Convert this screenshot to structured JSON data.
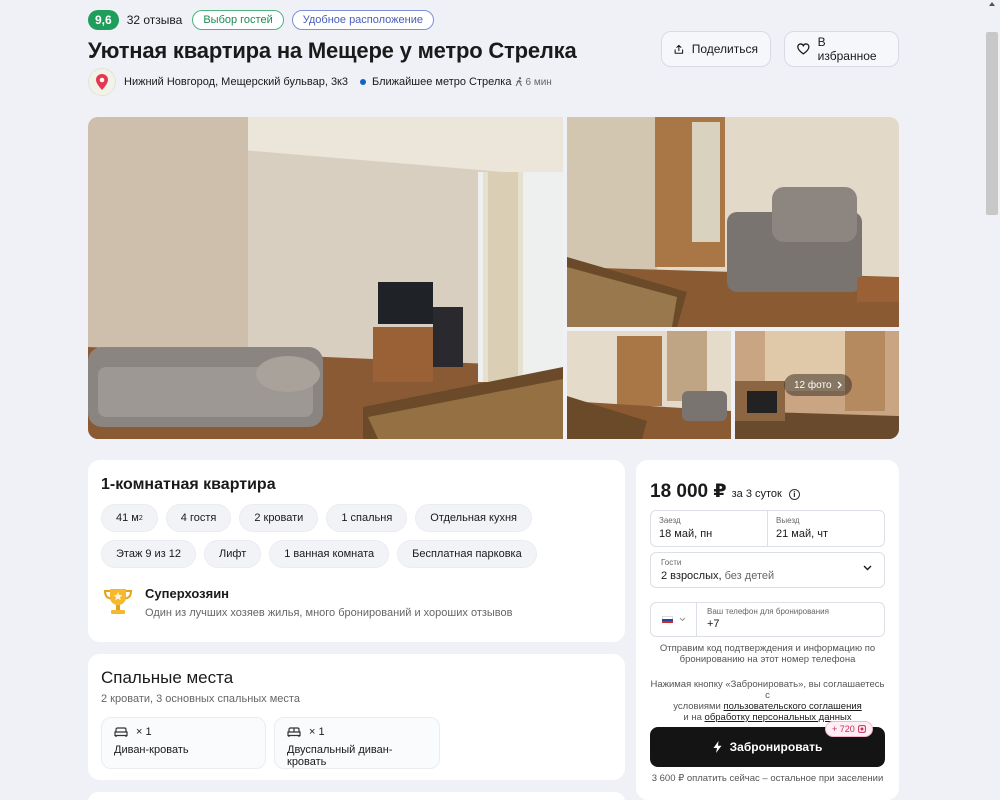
{
  "header": {
    "rating": "9,6",
    "reviews": "32 отзыва",
    "badges": [
      "Выбор гостей",
      "Удобное расположение"
    ],
    "title": "Уютная квартира на Мещере у метро Стрелка",
    "address": "Нижний Новгород, Мещерский бульвар, 3к3",
    "metro": "Ближайшее метро Стрелка",
    "walk_time": "6 мин",
    "share_label": "Поделиться",
    "favorite_label": "В избранное"
  },
  "gallery": {
    "photos_button": "12 фото"
  },
  "info": {
    "heading": "1-комнатная квартира",
    "area_value": "41 м",
    "area_unit_sup": "2",
    "chips_row1": [
      "4 гостя",
      "2 кровати",
      "1 спальня",
      "Отдельная кухня"
    ],
    "chips_row2": [
      "Этаж 9 из 12",
      "Лифт",
      "1 ванная комната",
      "Бесплатная парковка"
    ],
    "host_title": "Суперхозяин",
    "host_desc": "Один из лучших хозяев жилья, много бронирований и хороших отзывов"
  },
  "beds": {
    "heading": "Спальные места",
    "subtitle": "2 кровати, 3 основных спальных места",
    "items": [
      {
        "count": "× 1",
        "name": "Диван-кровать"
      },
      {
        "count": "× 1",
        "name": "Двуспальный диван-кровать"
      }
    ]
  },
  "booking": {
    "price": "18 000 ₽",
    "period": "за 3 суток",
    "checkin_label": "Заезд",
    "checkin_value": "18 май, пн",
    "checkout_label": "Выезд",
    "checkout_value": "21 май, чт",
    "guests_label": "Гости",
    "guests_value": "2 взрослых,",
    "guests_value_extra": "без детей",
    "phone_label": "Ваш телефон для бронирования",
    "phone_value": "+7",
    "phone_note_1": "Отправим код подтверждения и информацию по",
    "phone_note_2": "бронированию на этот номер телефона",
    "terms_1": "Нажимая кнопку «Забронировать», вы соглашаетесь с",
    "terms_2": "условиями",
    "terms_link_1": "пользовательского соглашения",
    "terms_3": "и на",
    "terms_link_2": "обработку персональных данных",
    "book_button": "Забронировать",
    "bonus": "+ 720",
    "pay_note": "3 600 ₽ оплатить сейчас – остальное при заселении"
  },
  "colors": {
    "rating_bg": "#1e9e5a",
    "badge_green": "#1e8a52",
    "badge_blue": "#4a5cb8",
    "metro": "#1565c0",
    "button_dark": "#141414",
    "page_bg": "#eff1f7"
  }
}
